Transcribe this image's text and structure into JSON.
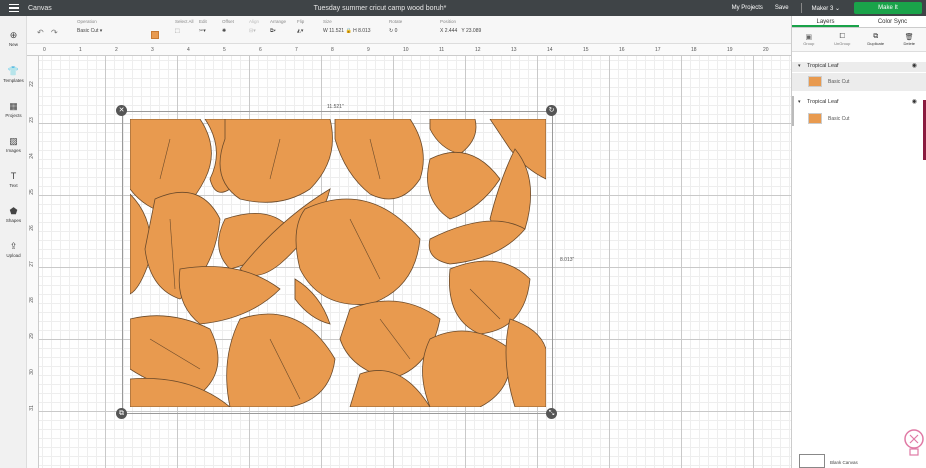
{
  "header": {
    "app_title": "Canvas",
    "doc_title": "Tuesday summer cricut camp wood boruh*",
    "my_projects": "My Projects",
    "save": "Save",
    "machine": "Maker 3",
    "make_button": "Make It",
    "accent_color": "#1aa34a"
  },
  "toolbar": {
    "operation_label": "Operation",
    "operation_value": "Basic Cut",
    "swatch_color": "#e89a4f",
    "select_all": "Select All",
    "edit": "Edit",
    "offset": "Offset",
    "align": "Align",
    "arrange": "Arrange",
    "flip": "Flip",
    "size_label": "Size",
    "width_prefix": "W",
    "width_value": "11.521",
    "height_prefix": "H",
    "height_value": "8.013",
    "rotate_label": "Rotate",
    "rotate_value": "0",
    "position_label": "Position",
    "x_prefix": "X",
    "x_value": "2.444",
    "y_prefix": "Y",
    "y_value": "23.089"
  },
  "leftbar": {
    "items": [
      {
        "label": "New",
        "icon": "plus-circle-icon"
      },
      {
        "label": "Templates",
        "icon": "shirt-icon"
      },
      {
        "label": "Projects",
        "icon": "projects-icon"
      },
      {
        "label": "Images",
        "icon": "image-icon"
      },
      {
        "label": "Text",
        "icon": "text-icon"
      },
      {
        "label": "Shapes",
        "icon": "shapes-icon"
      },
      {
        "label": "Upload",
        "icon": "upload-icon"
      }
    ]
  },
  "canvas": {
    "top_ruler": [
      "0",
      "1",
      "2",
      "3",
      "4",
      "5",
      "6",
      "7",
      "8",
      "9",
      "10",
      "11",
      "12",
      "13",
      "14",
      "15",
      "16",
      "17",
      "18",
      "19",
      "20"
    ],
    "left_ruler": [
      "22",
      "23",
      "24",
      "25",
      "26",
      "27",
      "28",
      "29",
      "30",
      "31"
    ],
    "width_dim": "11.521\"",
    "height_dim": "8.013\"",
    "leaf_color": "#e89a4f"
  },
  "panel": {
    "tab_layers": "Layers",
    "tab_color_sync": "Color Sync",
    "tools": [
      "Group",
      "UnGroup",
      "Duplicate",
      "Delete"
    ],
    "groups": [
      {
        "name": "Tropical Leaf",
        "layer": "Basic Cut"
      },
      {
        "name": "Tropical Leaf",
        "layer": "Basic Cut"
      }
    ],
    "blank_canvas": "Blank Canvas"
  }
}
